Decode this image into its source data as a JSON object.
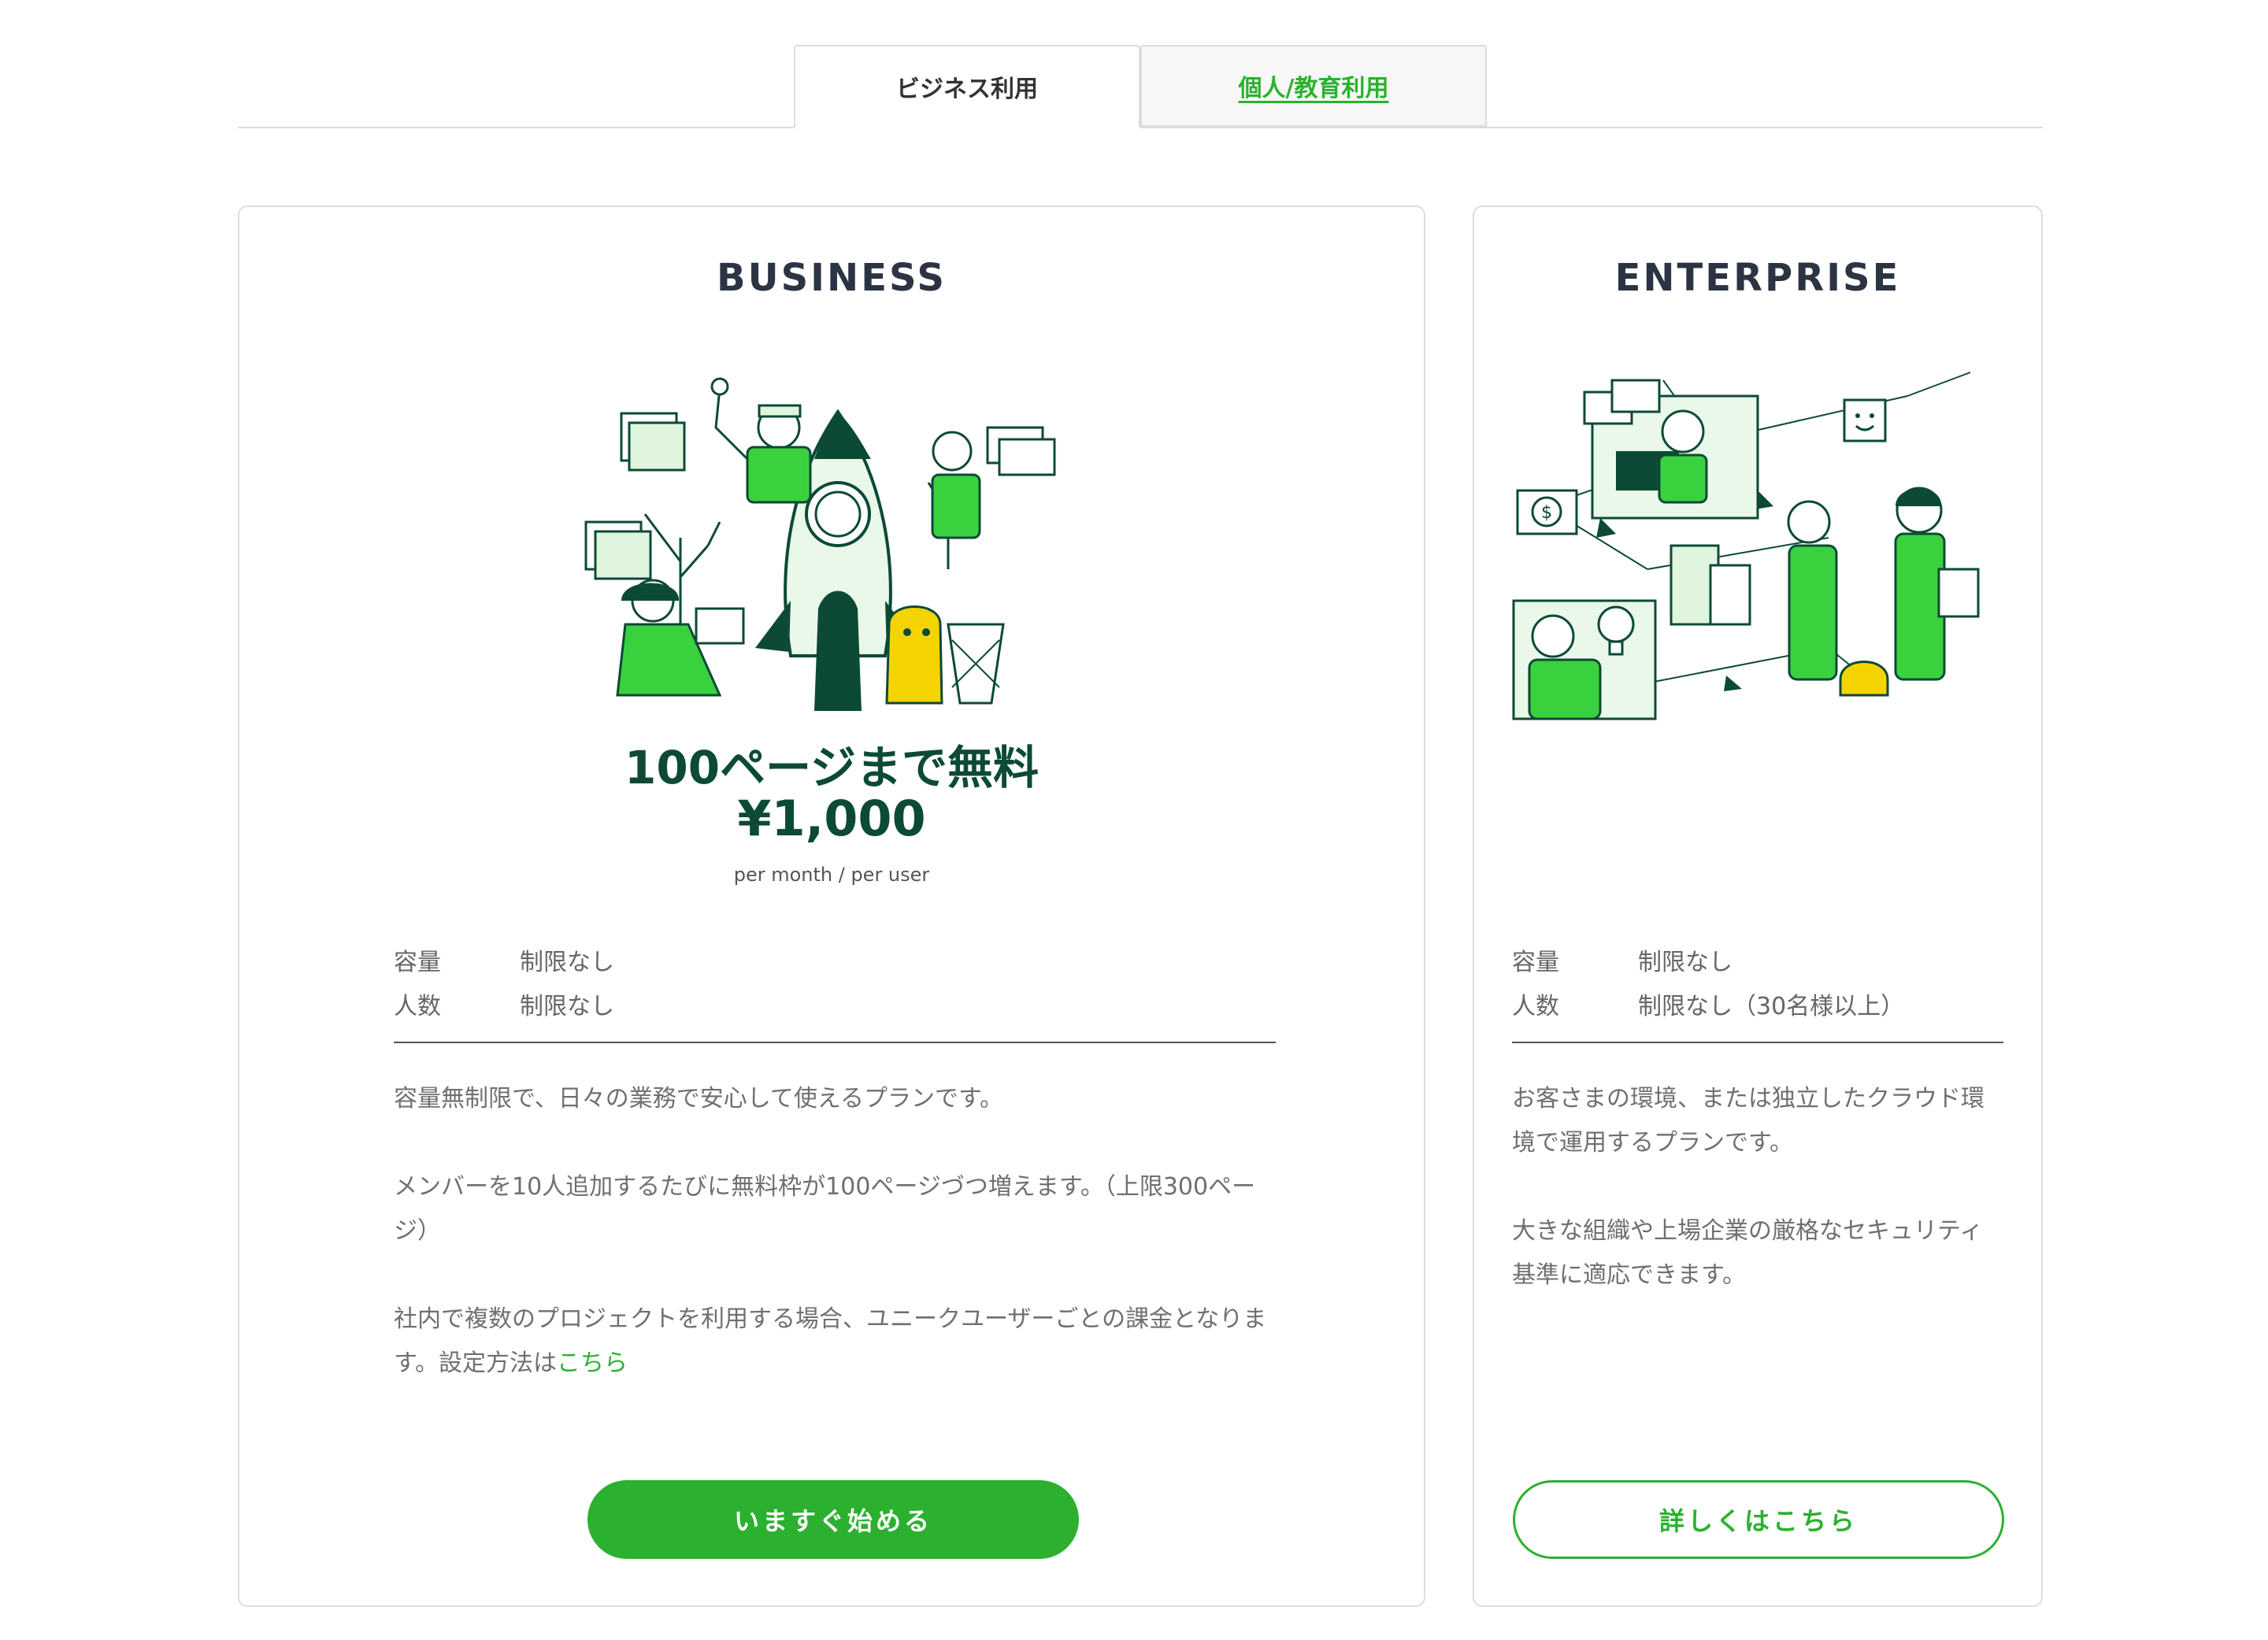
{
  "tabs": [
    {
      "label": "ビジネス利用",
      "active": true
    },
    {
      "label": "個人/教育利用",
      "active": false
    }
  ],
  "business": {
    "title": "BUSINESS",
    "free_label": "100ページまで無料",
    "price": "¥1,000",
    "price_unit": "per month / per user",
    "specs": [
      {
        "label": "容量",
        "value": "制限なし"
      },
      {
        "label": "人数",
        "value": "制限なし"
      }
    ],
    "desc1": "容量無制限で、日々の業務で安心して使えるプランです。",
    "desc2": "メンバーを10人追加するたびに無料枠が100ページづつ増えます。（上限300ページ）",
    "desc3": "社内で複数のプロジェクトを利用する場合、ユニークユーザーごとの課金となります。設定方法は",
    "desc3_link": "こちら",
    "button": "いますぐ始める"
  },
  "enterprise": {
    "title": "ENTERPRISE",
    "specs": [
      {
        "label": "容量",
        "value": "制限なし"
      },
      {
        "label": "人数",
        "value": "制限なし（30名様以上）"
      }
    ],
    "desc1": "お客さまの環境、または独立したクラウド環境で運用するプランです。",
    "desc2": "大きな組織や上場企業の厳格なセキュリティ基準に適応できます。",
    "button": "詳しくはこちら"
  },
  "colors": {
    "accent": "#2bb12f",
    "dark_green": "#0c4a36",
    "title": "#2c3444",
    "illustration_light": "#dff5de",
    "illustration_yellow": "#f4d400"
  }
}
